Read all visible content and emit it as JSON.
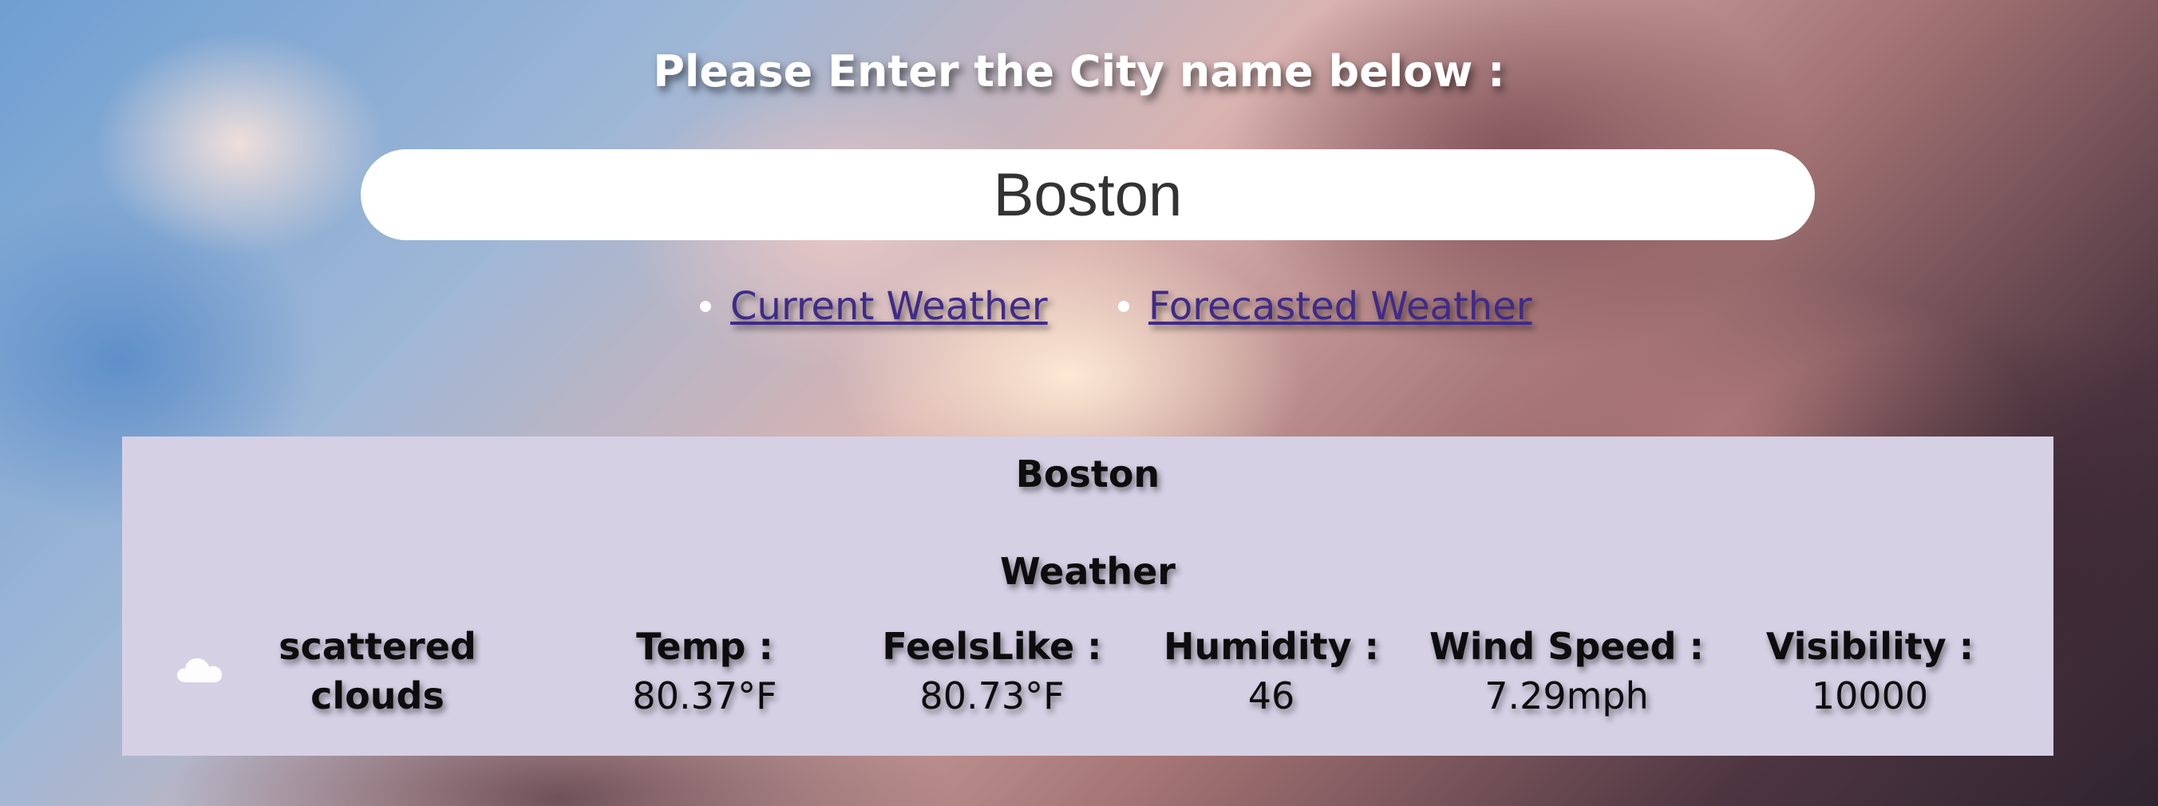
{
  "prompt": "Please Enter the City name below :",
  "search": {
    "value": "Boston"
  },
  "nav": {
    "current": "Current Weather",
    "forecast": "Forecasted Weather"
  },
  "weather": {
    "city": "Boston",
    "heading": "Weather",
    "icon": "cloud-icon",
    "description_line1": "scattered",
    "description_line2": "clouds",
    "stats": {
      "temp": {
        "label": "Temp :",
        "value": "80.37°F"
      },
      "feels_like": {
        "label": "FeelsLike :",
        "value": "80.73°F"
      },
      "humidity": {
        "label": "Humidity :",
        "value": "46"
      },
      "wind_speed": {
        "label": "Wind Speed :",
        "value": "7.29mph"
      },
      "visibility": {
        "label": "Visibility :",
        "value": "10000"
      }
    }
  },
  "colors": {
    "panel": "#d6d0e5",
    "link": "#3f2a8a",
    "input_bg": "#ffffff"
  }
}
